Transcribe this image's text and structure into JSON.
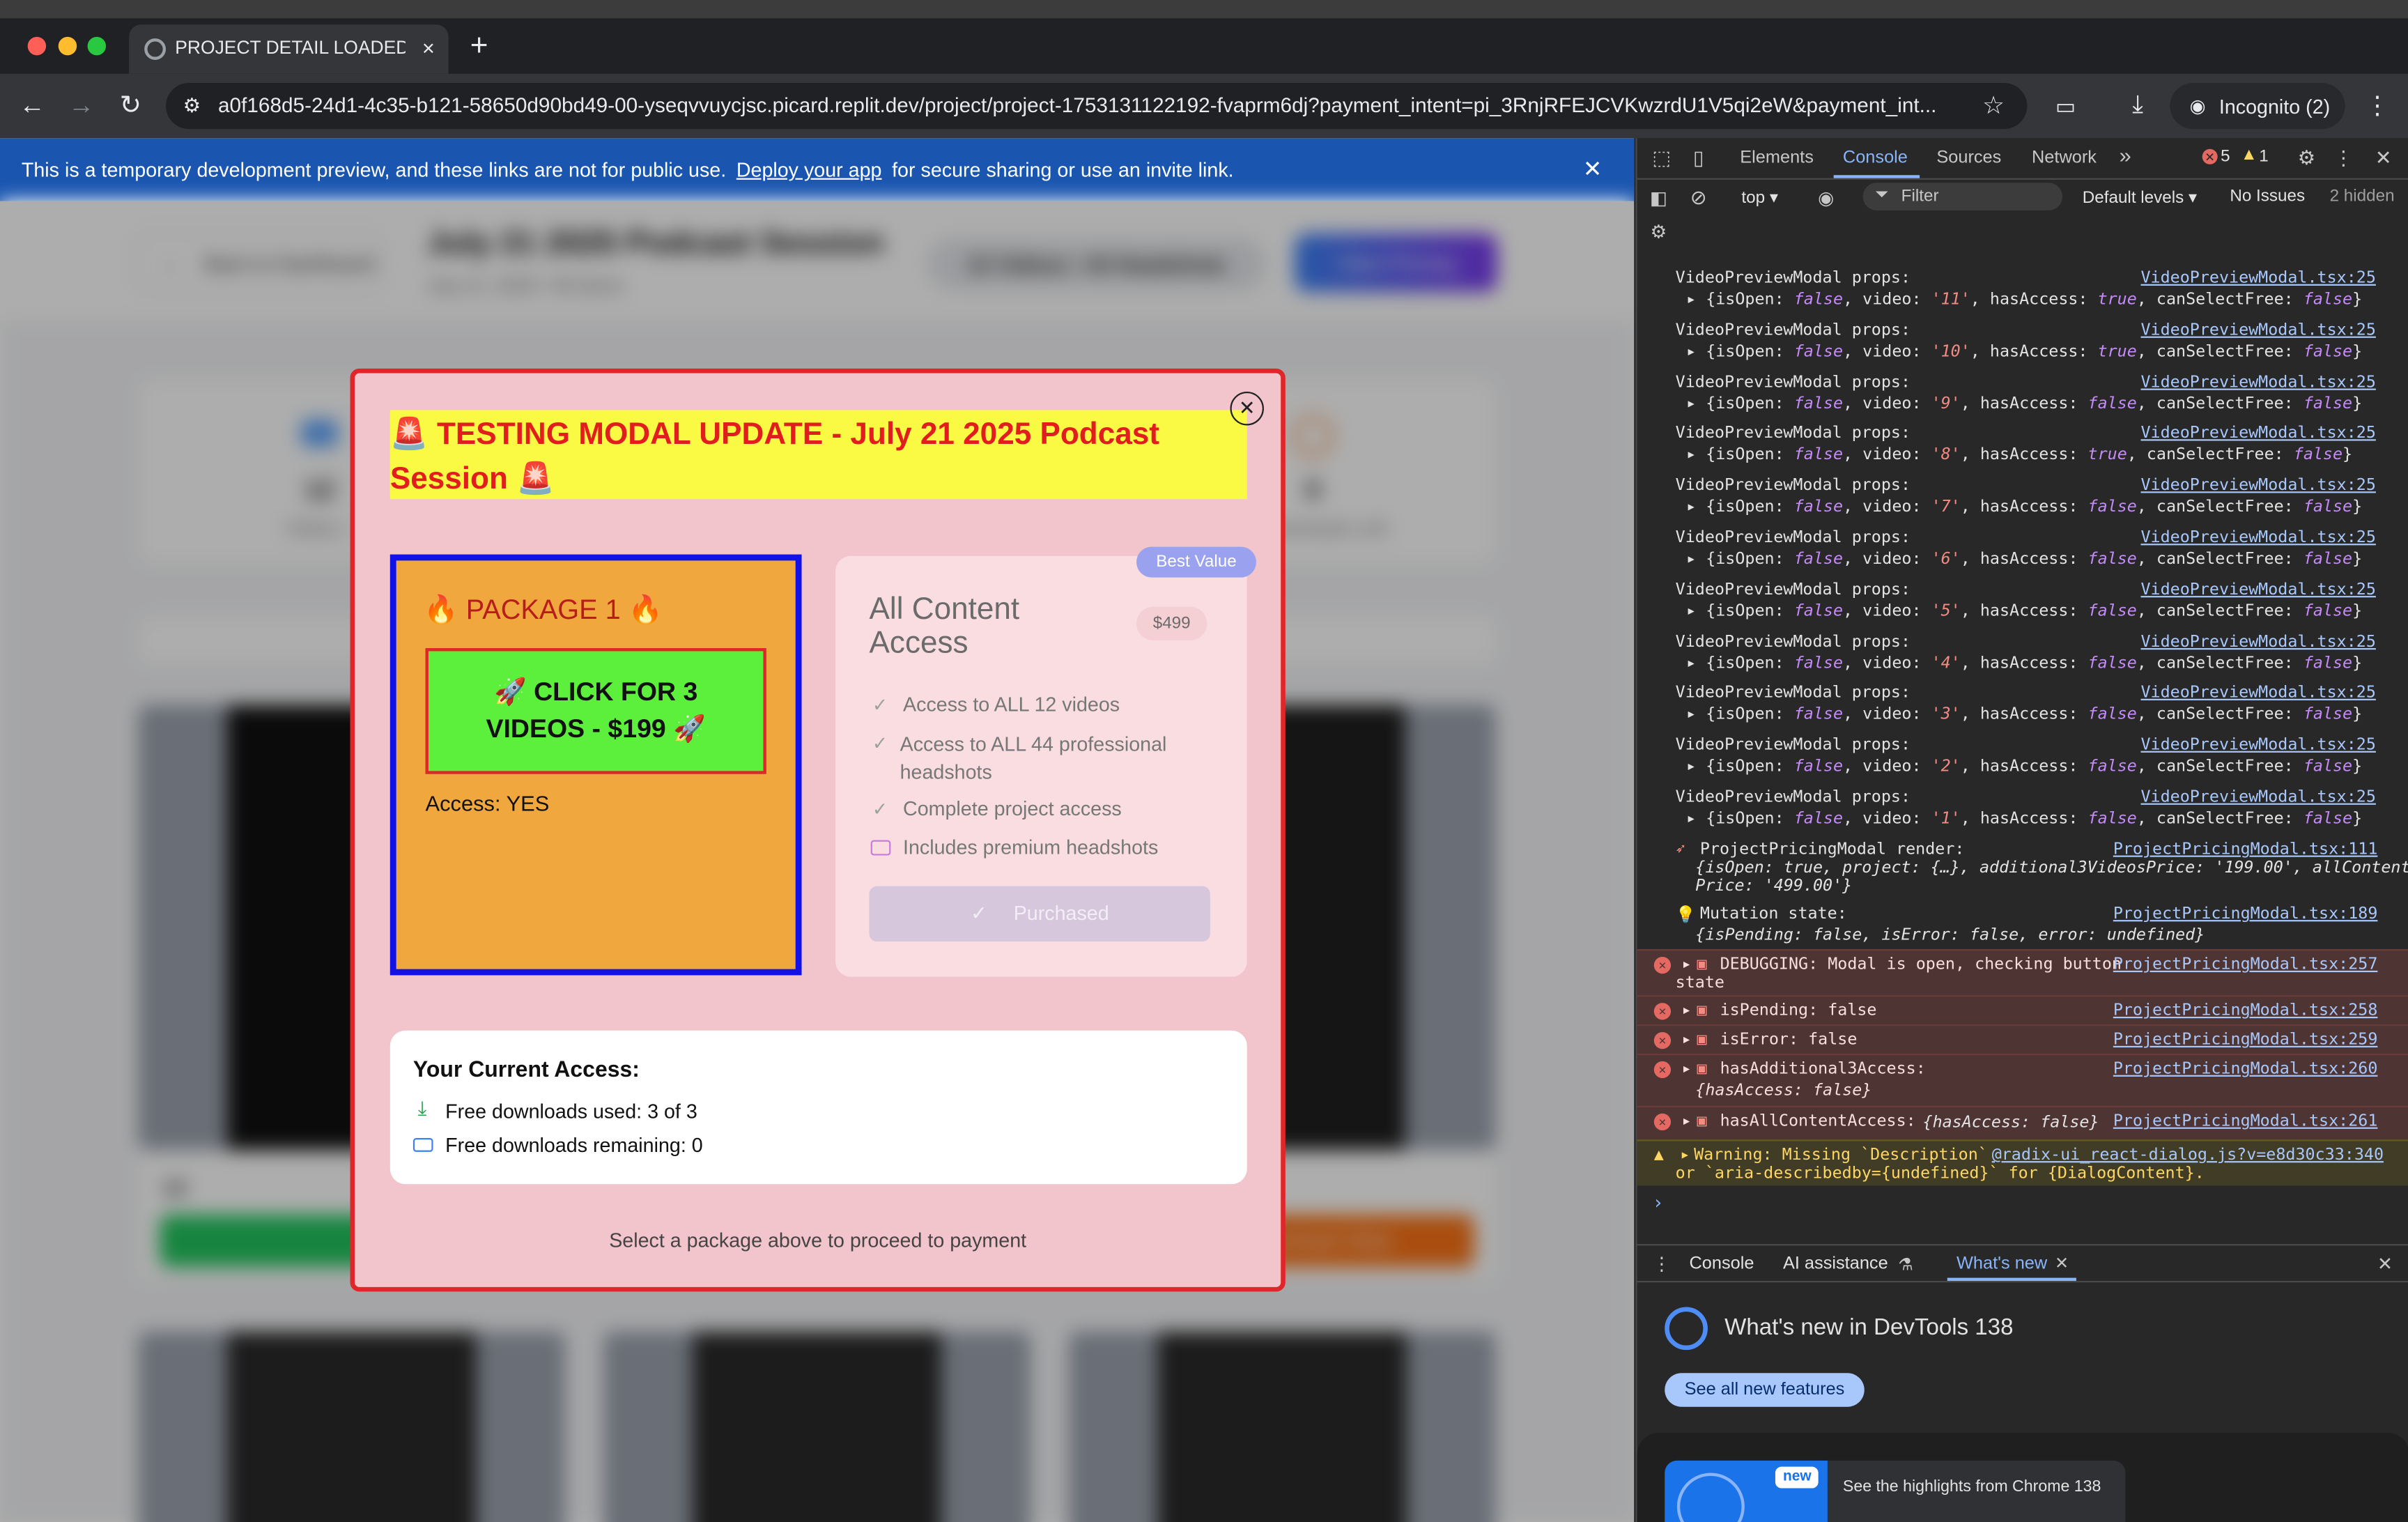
{
  "browser": {
    "tab_title": "PROJECT DETAIL LOADED - /",
    "url": "a0f168d5-24d1-4c35-b121-58650d90bd49-00-yseqvvuycjsc.picard.replit.dev/project/project-1753131122192-fvaprm6dj?payment_intent=pi_3RnjRFEJCVKwzrdU1V5qi2eW&payment_int...",
    "profile_label": "Incognito (2)"
  },
  "banner": {
    "text_before": "This is a temporary development preview, and these links are not for public use.",
    "link": "Deploy your app",
    "text_after": "for secure sharing or use an invite link."
  },
  "background_page": {
    "back_label": "Back to Dashboard",
    "title": "July 21 2025 Podcast Session",
    "subtitle": "July 21, 2025 • 56 items",
    "count_badge": "12 Videos • 44 Headshots",
    "pricing_button": "View Pricing",
    "stat_left_value": "12",
    "stat_left_label": "Videos",
    "stat_right_value": "0",
    "stat_right_label": "Downloads Left",
    "card_number": "12",
    "card_button_right": "Download Video"
  },
  "modal": {
    "title": "🚨 TESTING MODAL UPDATE - July 21 2025 Podcast Session 🚨",
    "package1": {
      "title": "🔥 PACKAGE 1 🔥",
      "button": "🚀 CLICK FOR 3 VIDEOS - $199 🚀",
      "access": "Access: YES"
    },
    "package2": {
      "badge": "Best Value",
      "title": "All Content Access",
      "price": "$499",
      "features": [
        "Access to ALL 12 videos",
        "Access to ALL 44 professional headshots",
        "Complete project access",
        "Includes premium headshots"
      ],
      "button": "Purchased"
    },
    "access": {
      "heading": "Your Current Access:",
      "used": "Free downloads used: 3 of 3",
      "remaining": "Free downloads remaining: 0"
    },
    "footer": "Select a package above to proceed to payment"
  },
  "devtools": {
    "tabs": [
      "Elements",
      "Console",
      "Sources",
      "Network"
    ],
    "error_count": "5",
    "warning_count": "1",
    "context": "top",
    "filter_placeholder": "Filter",
    "levels": "Default levels",
    "issues": "No Issues",
    "hidden": "2 hidden",
    "logs": {
      "vp_label": "VideoPreviewModal props:",
      "vp_link": "VideoPreviewModal.tsx:25",
      "vp_rows": [
        {
          "video": "'11'",
          "access": "true"
        },
        {
          "video": "'10'",
          "access": "true"
        },
        {
          "video": "'9'",
          "access": "false"
        },
        {
          "video": "'8'",
          "access": "true"
        },
        {
          "video": "'7'",
          "access": "false"
        },
        {
          "video": "'6'",
          "access": "false"
        },
        {
          "video": "'5'",
          "access": "false"
        },
        {
          "video": "'4'",
          "access": "false"
        },
        {
          "video": "'3'",
          "access": "false"
        },
        {
          "video": "'2'",
          "access": "false"
        },
        {
          "video": "'1'",
          "access": "false"
        }
      ],
      "render_label": "ProjectPricingModal render:",
      "render_link": "ProjectPricingModal.tsx:111",
      "render_obj_1": "{isOpen: true, project: {…}, additional3VideosPrice: '199.00', allContent",
      "render_obj_2": "Price: '499.00'}",
      "mutation_label": "Mutation state:",
      "mutation_link": "ProjectPricingModal.tsx:189",
      "mutation_obj": "{isPending: false, isError: false, error: undefined}",
      "debug_label": "DEBUGGING: Modal is open, checking button",
      "debug_label_2": "state",
      "debug_link": "ProjectPricingModal.tsx:257",
      "pending_label": "isPending: false",
      "pending_link": "ProjectPricingModal.tsx:258",
      "iserror_label": "isError: false",
      "iserror_link": "ProjectPricingModal.tsx:259",
      "add3_label": "hasAdditional3Access:",
      "add3_obj": "{hasAccess: false}",
      "add3_link": "ProjectPricingModal.tsx:260",
      "allc_label": "hasAllContentAccess:",
      "allc_obj": "{hasAccess: false}",
      "allc_link": "ProjectPricingModal.tsx:261",
      "warn_label": "Warning: Missing `Description`",
      "warn_label_2": "or `aria-describedby={undefined}` for {DialogContent}.",
      "warn_link": "@radix-ui_react-dialog.js?v=e8d30c33:340"
    },
    "drawer": {
      "tabs": [
        "Console",
        "AI assistance",
        "What's new"
      ],
      "heading": "What's new in DevTools 138",
      "see_all": "See all new features",
      "new_badge": "new",
      "highlights": "See the highlights from Chrome 138"
    }
  },
  "colors": {
    "modal_border": "#e0262a",
    "modal_bg": "#f2c4cc",
    "title_bg": "#fafa45",
    "package1_bg": "#f0a83e",
    "package1_border": "#1212e8",
    "cta_bg": "#5cf03c",
    "banner_bg": "#1a56b0"
  }
}
